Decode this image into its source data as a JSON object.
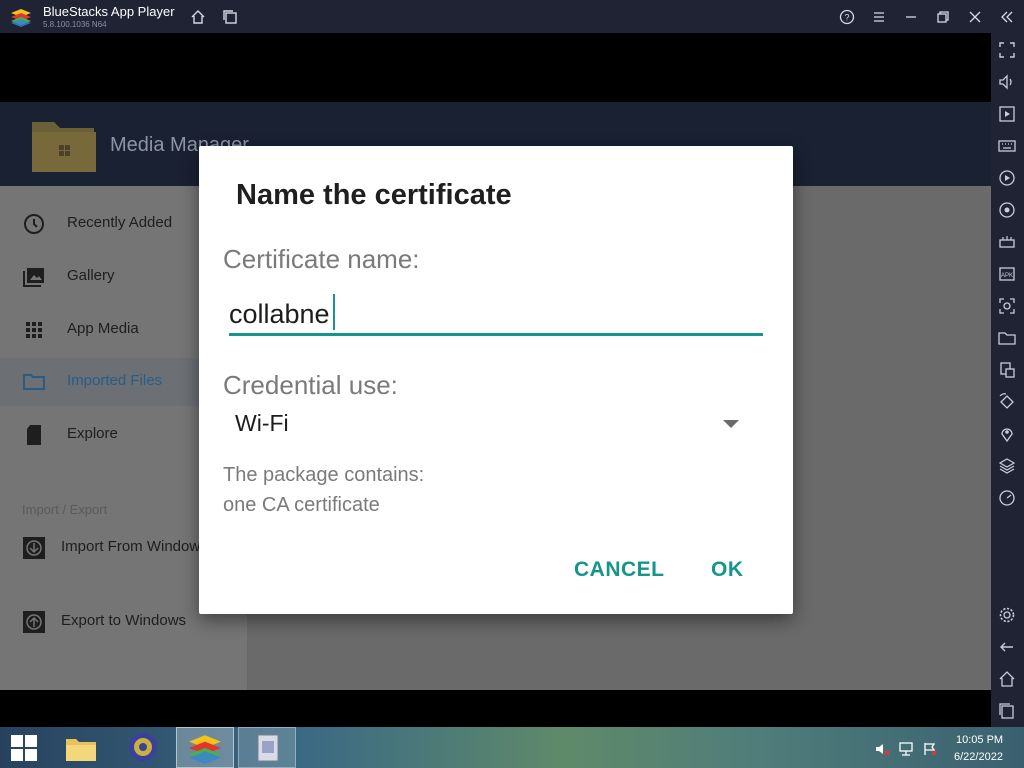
{
  "window": {
    "title": "BlueStacks App Player",
    "version": "5.8.100.1036 N64",
    "controls": [
      "help-icon",
      "menu-icon",
      "minimize-icon",
      "restore-icon",
      "close-icon",
      "collapse-sidebar-icon"
    ]
  },
  "sidebar_icons": [
    "fullscreen-icon",
    "volume-icon",
    "media-icon",
    "keyboard-icon",
    "record-icon",
    "macro-icon",
    "gamepad-icon",
    "apk-icon",
    "screenshot-icon",
    "folder-icon",
    "multi-instance-icon",
    "rotate-icon",
    "location-icon",
    "layers-icon",
    "eco-mode-icon",
    "settings-icon",
    "back-icon",
    "home-icon",
    "recents-icon"
  ],
  "app": {
    "title": "Media Manager",
    "drawer": {
      "items": [
        {
          "label": "Recently Added",
          "icon": "clock-icon"
        },
        {
          "label": "Gallery",
          "icon": "gallery-icon"
        },
        {
          "label": "App Media",
          "icon": "grid-icon"
        },
        {
          "label": "Imported Files",
          "icon": "folder-icon"
        },
        {
          "label": "Explore",
          "icon": "sdcard-icon"
        }
      ],
      "section_title": "Import / Export",
      "actions": [
        {
          "label": "Import From Windows",
          "icon": "import-icon"
        },
        {
          "label": "Export to Windows",
          "icon": "export-icon"
        }
      ]
    }
  },
  "dialog": {
    "title": "Name the certificate",
    "name_label": "Certificate name:",
    "name_value": "collabne",
    "credential_label": "Credential use:",
    "credential_value": "Wi-Fi",
    "info_line1": "The package contains:",
    "info_line2": "one CA certificate",
    "cancel_label": "CANCEL",
    "ok_label": "OK",
    "accent_color": "#16958b"
  },
  "taskbar": {
    "time": "10:05 PM",
    "date": "6/22/2022"
  }
}
